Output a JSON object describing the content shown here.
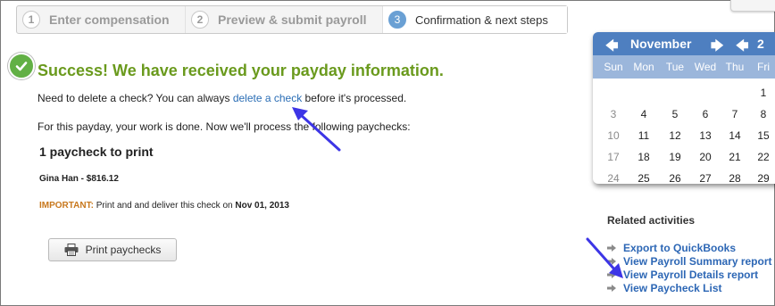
{
  "steps": [
    {
      "num": "1",
      "label": "Enter compensation"
    },
    {
      "num": "2",
      "label": "Preview & submit payroll"
    },
    {
      "num": "3",
      "label": "Confirmation & next steps"
    }
  ],
  "success": {
    "headline": "Success! We have received your payday information.",
    "delete_prefix": "Need to delete a check? You can always ",
    "delete_link": "delete a check",
    "delete_suffix": " before it's processed.",
    "done_text": "For this payday, your work is done. Now we'll process the following paychecks:",
    "paycheck_count": "1 paycheck to print",
    "payee": "Gina Han - $816.12",
    "important_label": "IMPORTANT:",
    "important_text": " Print and and deliver this check on ",
    "important_date": "Nov 01, 2013",
    "print_button": "Print paychecks"
  },
  "calendar": {
    "month": "November",
    "year_partial": "2",
    "weekdays": [
      "Sun",
      "Mon",
      "Tue",
      "Wed",
      "Thu",
      "Fri"
    ],
    "weeks": [
      [
        "",
        "",
        "",
        "",
        "",
        "1"
      ],
      [
        "3",
        "4",
        "5",
        "6",
        "7",
        "8"
      ],
      [
        "10",
        "11",
        "12",
        "13",
        "14",
        "15"
      ],
      [
        "17",
        "18",
        "19",
        "20",
        "21",
        "22"
      ],
      [
        "24",
        "25",
        "26",
        "27",
        "28",
        "29"
      ]
    ]
  },
  "related": {
    "title": "Related activities",
    "items": [
      "Export to QuickBooks",
      "View Payroll Summary report",
      "View Payroll Details report",
      "View Paycheck List"
    ]
  },
  "colors": {
    "accent": "#4e7fc0",
    "success": "#6a9a1d",
    "important": "#c8781d",
    "link": "#2d67b5",
    "annotation": "#3d35e6"
  }
}
